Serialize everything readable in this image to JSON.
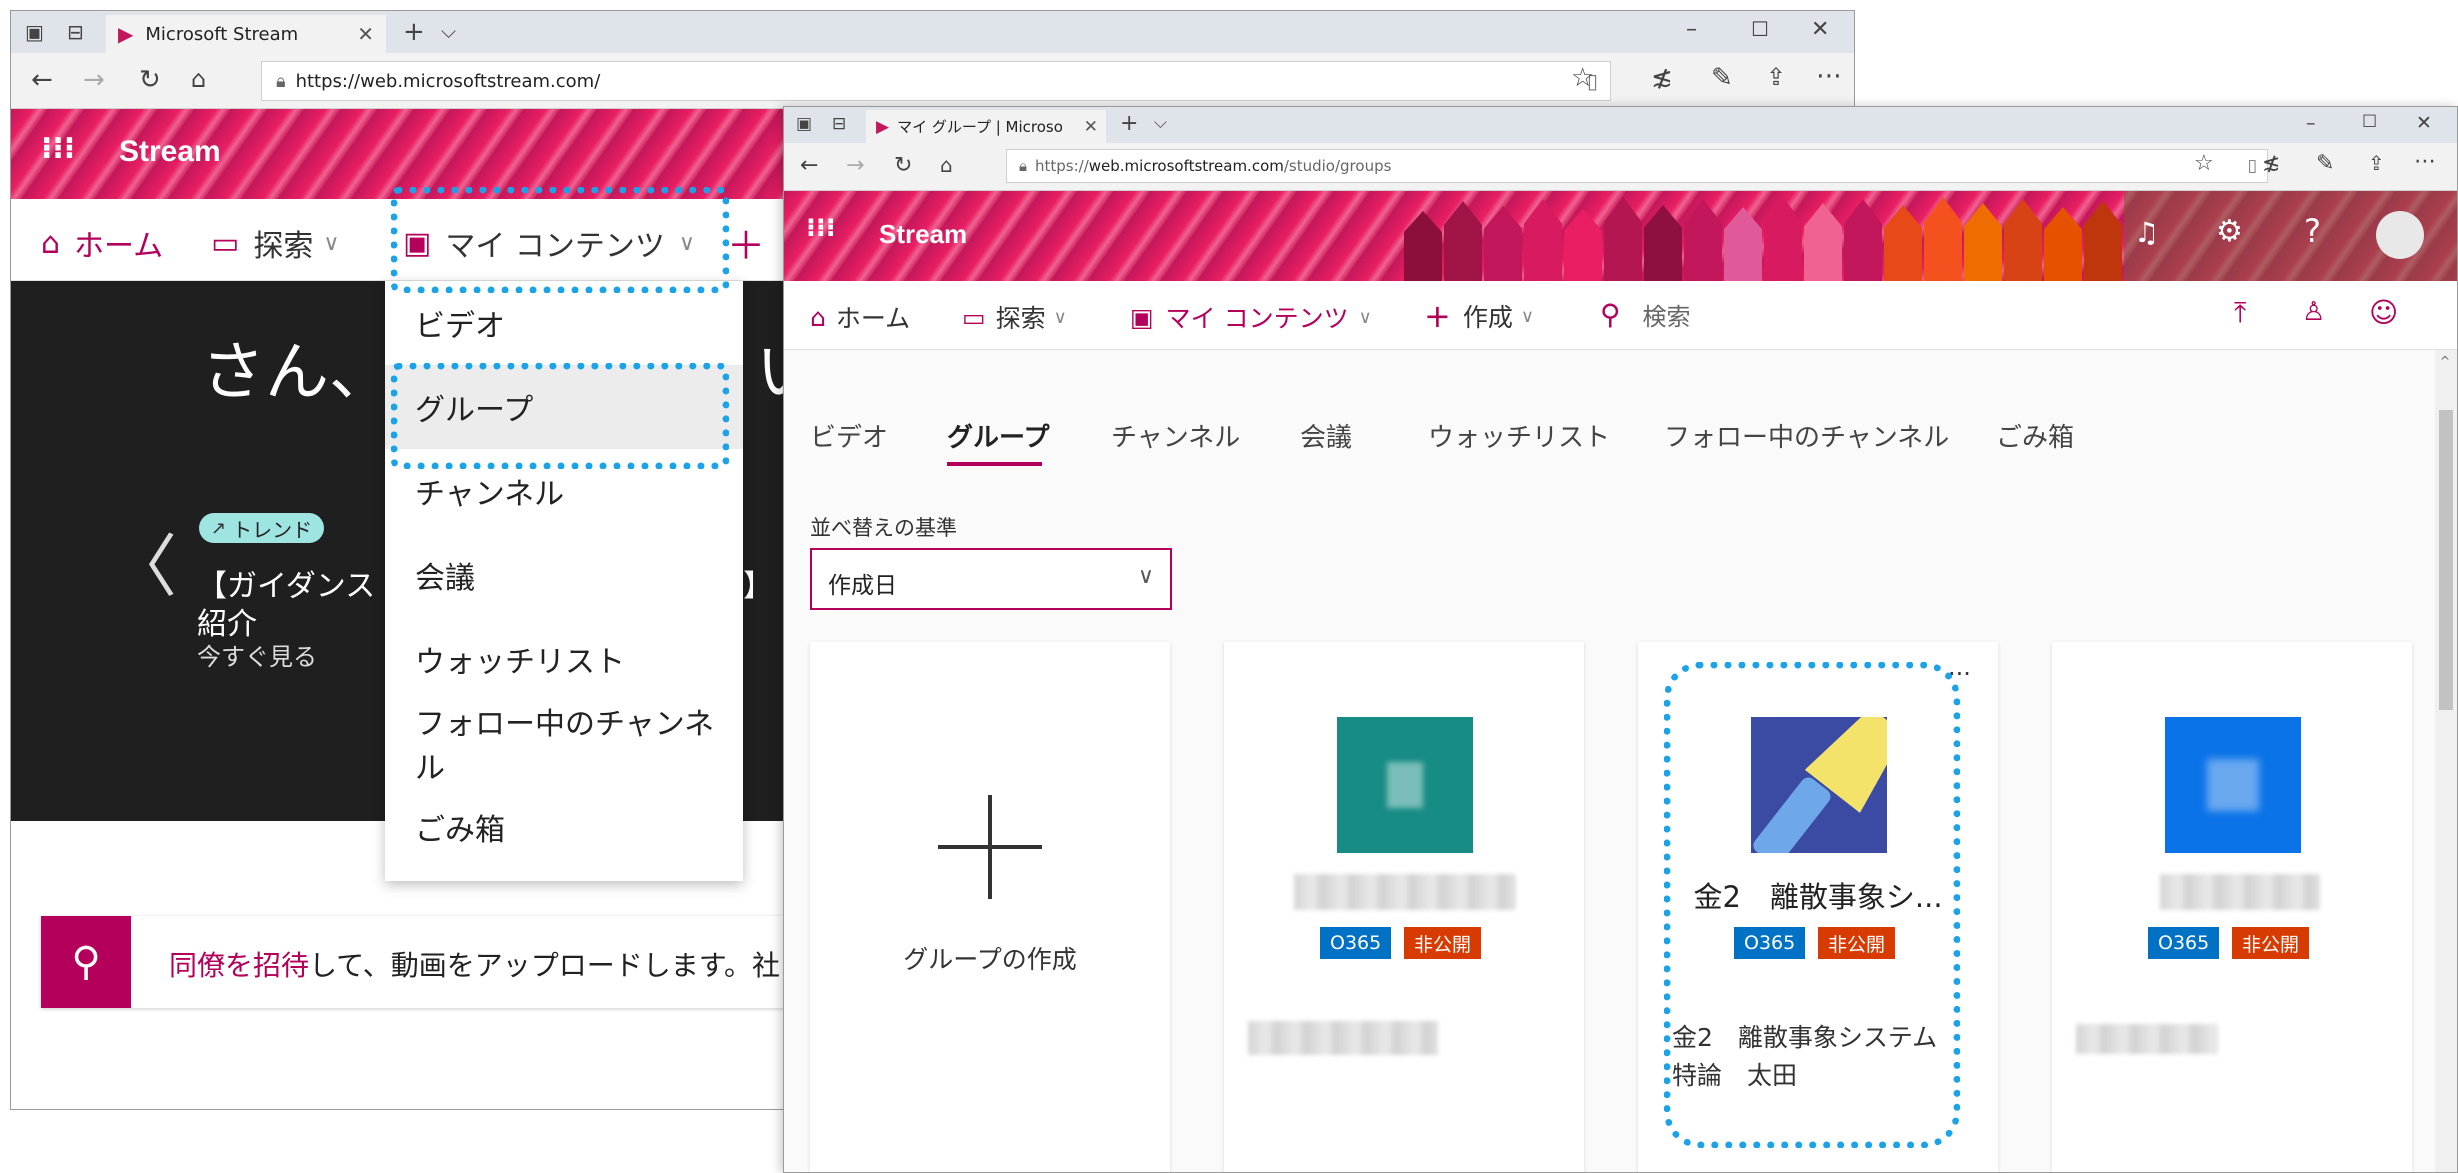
{
  "window1": {
    "tab_title": "Microsoft Stream",
    "url": "https://web.microsoftstream.com/",
    "app_name": "Stream",
    "nav": {
      "home": "ホーム",
      "explore": "探索",
      "my_content": "マイ コンテンツ",
      "create_partial": "＋"
    },
    "hero": {
      "greeting": "さん、",
      "greeting_tail": "い",
      "trend_badge": "トレンド",
      "video_title_line1": "【ガイダンス",
      "video_title_tail": "】 教",
      "video_title_line2": "紹介",
      "watch_now": "今すぐ見る",
      "prev_arrow": "〈"
    },
    "dropdown_menu": [
      "ビデオ",
      "グループ",
      "チャンネル",
      "会議",
      "ウォッチリスト",
      "フォロー中のチャンネル",
      "ごみ箱"
    ],
    "invite": {
      "link_text": "同僚を招待",
      "text": "して、動画をアップロードします。社"
    }
  },
  "window2": {
    "tab_title": "マイ グループ | Microsoft S",
    "url_prefix": "https://",
    "url_domain": "web.microsoftstream.com",
    "url_path": "/studio/groups",
    "app_name": "Stream",
    "nav": {
      "home": "ホーム",
      "explore": "探索",
      "my_content": "マイ コンテンツ",
      "create": "作成",
      "search": "検索"
    },
    "subtabs": [
      "ビデオ",
      "グループ",
      "チャンネル",
      "会議",
      "ウォッチリスト",
      "フォロー中のチャンネル",
      "ごみ箱"
    ],
    "active_subtab": "グループ",
    "sort": {
      "label": "並べ替えの基準",
      "value": "作成日"
    },
    "create_group_label": "グループの作成",
    "badges": {
      "o365": "O365",
      "private": "非公開"
    },
    "highlighted_group": {
      "name": "金2　離散事象シ...",
      "description_line1": "金2　離散事象システム",
      "description_line2": "特論　太田",
      "more": "···"
    }
  },
  "colors": {
    "accent": "#b4005a",
    "highlight": "#1aa3e8",
    "o365_badge": "#0072c6",
    "private_badge": "#d83b01",
    "teal_tile": "#178c85",
    "indigo_tile": "#3b4ba3",
    "blue_tile": "#0a73e8"
  }
}
